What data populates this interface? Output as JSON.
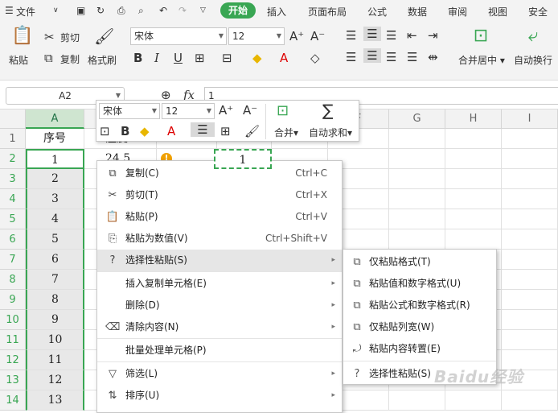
{
  "menubar": {
    "file": "文件",
    "tabs": [
      "开始",
      "插入",
      "页面布局",
      "公式",
      "数据",
      "审阅",
      "视图",
      "安全"
    ]
  },
  "ribbon": {
    "paste": "粘贴",
    "cut": "剪切",
    "copy": "复制",
    "format_painter": "格式刷",
    "font": "宋体",
    "size": "12",
    "merge_center": "合并居中",
    "wrap": "自动换行"
  },
  "formula": {
    "namebox": "A2",
    "fx": "fx",
    "value": "1"
  },
  "columns": [
    "A",
    "B",
    "C",
    "D",
    "E",
    "F",
    "G",
    "H",
    "I"
  ],
  "rows": [
    "1",
    "2",
    "3",
    "4",
    "5",
    "6",
    "7",
    "8",
    "9",
    "10",
    "11",
    "12",
    "13",
    "14"
  ],
  "colA": [
    "序号",
    "1",
    "2",
    "3",
    "4",
    "5",
    "6",
    "7",
    "8",
    "9",
    "10",
    "11",
    "12",
    "13"
  ],
  "colB_partial": [
    "温度",
    "24.5"
  ],
  "copied_value": "1",
  "mini_toolbar": {
    "font": "宋体",
    "size": "12",
    "merge": "合并",
    "autosum": "自动求和"
  },
  "context_menu": [
    {
      "icon": "copy-icon",
      "glyph": "⧉",
      "label": "复制(C)",
      "shortcut": "Ctrl+C"
    },
    {
      "icon": "cut-icon",
      "glyph": "✂",
      "label": "剪切(T)",
      "shortcut": "Ctrl+X"
    },
    {
      "icon": "paste-icon",
      "glyph": "📋",
      "label": "粘贴(P)",
      "shortcut": "Ctrl+V"
    },
    {
      "icon": "paste-values-icon",
      "glyph": "⎘",
      "label": "粘贴为数值(V)",
      "shortcut": "Ctrl+Shift+V"
    },
    {
      "icon": "paste-special-icon",
      "glyph": "?",
      "label": "选择性粘贴(S)",
      "shortcut": ""
    },
    {
      "icon": "",
      "glyph": "",
      "label": "插入复制单元格(E)",
      "shortcut": ""
    },
    {
      "icon": "",
      "glyph": "",
      "label": "删除(D)",
      "shortcut": ""
    },
    {
      "icon": "clear-icon",
      "glyph": "⌫",
      "label": "清除内容(N)",
      "shortcut": ""
    },
    {
      "icon": "",
      "glyph": "",
      "label": "批量处理单元格(P)",
      "shortcut": ""
    },
    {
      "icon": "filter-icon",
      "glyph": "▽",
      "label": "筛选(L)",
      "shortcut": ""
    },
    {
      "icon": "sort-icon",
      "glyph": "⇅",
      "label": "排序(U)",
      "shortcut": ""
    }
  ],
  "submenu": [
    {
      "icon": "paste-format-icon",
      "label": "仅粘贴格式(T)"
    },
    {
      "icon": "paste-values-format-icon",
      "label": "粘贴值和数字格式(U)"
    },
    {
      "icon": "paste-formula-format-icon",
      "label": "粘贴公式和数字格式(R)"
    },
    {
      "icon": "paste-colwidth-icon",
      "label": "仅粘贴列宽(W)"
    },
    {
      "icon": "paste-transpose-icon",
      "label": "粘贴内容转置(E)"
    },
    {
      "icon": "paste-special-icon",
      "label": "选择性粘贴(S)"
    }
  ],
  "watermark": "Baidu经验"
}
